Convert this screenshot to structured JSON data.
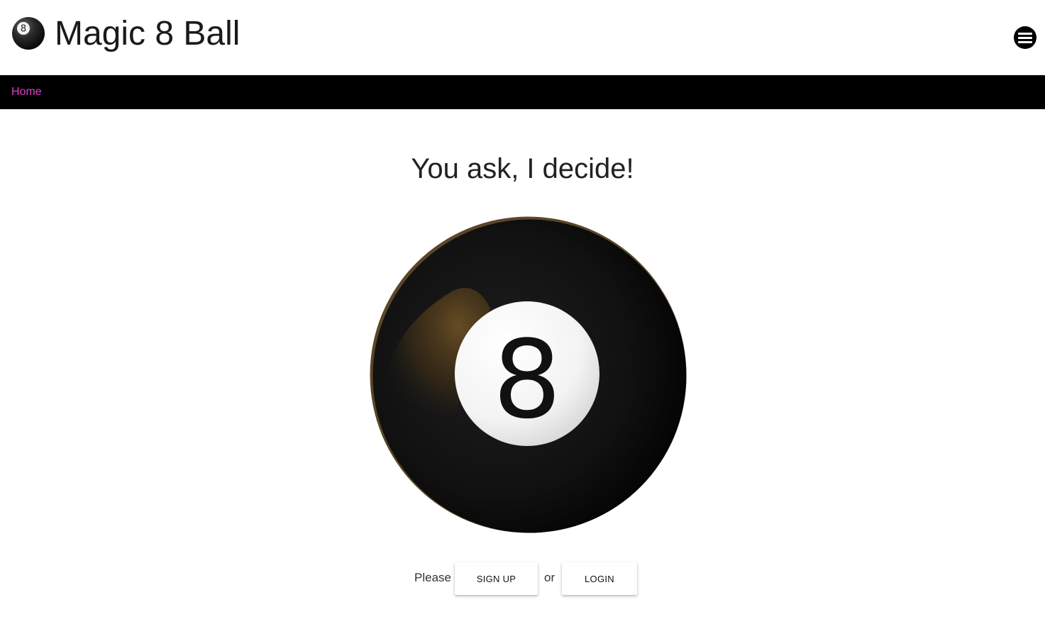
{
  "header": {
    "title": "Magic 8 Ball",
    "logo_icon": "eight-ball-icon",
    "menu_icon": "hamburger-menu-icon"
  },
  "nav": {
    "items": [
      {
        "label": "Home",
        "color": "#e040c8"
      }
    ]
  },
  "main": {
    "tagline": "You ask, I decide!",
    "ball": {
      "number": "8",
      "icon": "magic-8-ball-image"
    },
    "cta": {
      "prefix": "Please",
      "signup_label": "SIGN UP",
      "joiner": "or",
      "login_label": "LOGIN"
    }
  },
  "colors": {
    "nav_background": "#000000",
    "page_background": "#ffffff",
    "nav_link": "#e040c8"
  }
}
